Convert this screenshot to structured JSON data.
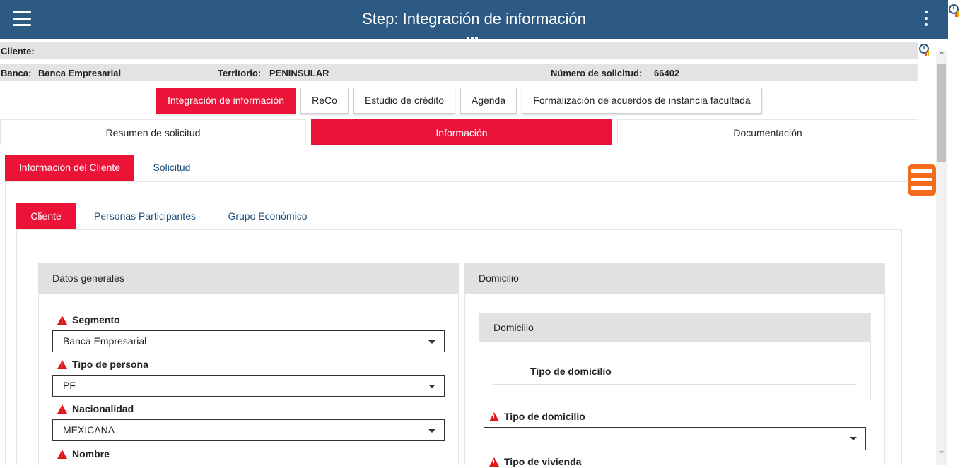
{
  "header": {
    "title": "Step: Integración de información",
    "menu_icon": "hamburger-icon",
    "more_icon": "kebab-icon"
  },
  "info": {
    "cliente_label": "Cliente:",
    "banca_label": "Banca:",
    "banca_value": "Banca Empresarial",
    "territorio_label": "Territorio:",
    "territorio_value": "PENINSULAR",
    "solicitud_label": "Número de solicitud:",
    "solicitud_value": "66402"
  },
  "steps": [
    {
      "label": "Integración de información",
      "active": true
    },
    {
      "label": "ReCo"
    },
    {
      "label": "Estudio de crédito"
    },
    {
      "label": "Agenda"
    },
    {
      "label": "Formalización de acuerdos de instancia facultada"
    }
  ],
  "nav_tabs": [
    {
      "label": "Resumen de solicitud"
    },
    {
      "label": "Información",
      "active": true
    },
    {
      "label": "Documentación"
    }
  ],
  "sub_tabs": [
    {
      "label": "Información del Cliente",
      "active": true
    },
    {
      "label": "Solicitud"
    }
  ],
  "inner_tabs": [
    {
      "label": "Cliente",
      "active": true
    },
    {
      "label": "Personas Participantes"
    },
    {
      "label": "Grupo Económico"
    }
  ],
  "datos_generales": {
    "title": "Datos generales",
    "fields": [
      {
        "label": "Segmento",
        "value": "Banca Empresarial"
      },
      {
        "label": "Tipo de persona",
        "value": "PF"
      },
      {
        "label": "Nacionalidad",
        "value": "MEXICANA"
      },
      {
        "label": "Nombre"
      }
    ]
  },
  "domicilio": {
    "title": "Domicilio",
    "inner_title": "Domicilio",
    "tipo_header": "Tipo de domicilio",
    "fields": [
      {
        "label": "Tipo de domicilio",
        "value": ""
      },
      {
        "label": "Tipo de vivienda"
      }
    ]
  },
  "colors": {
    "header_bg": "#2d5a82",
    "accent_red": "#ec1339",
    "fab_orange": "#f26a1b",
    "warning_red": "#e0161d"
  }
}
